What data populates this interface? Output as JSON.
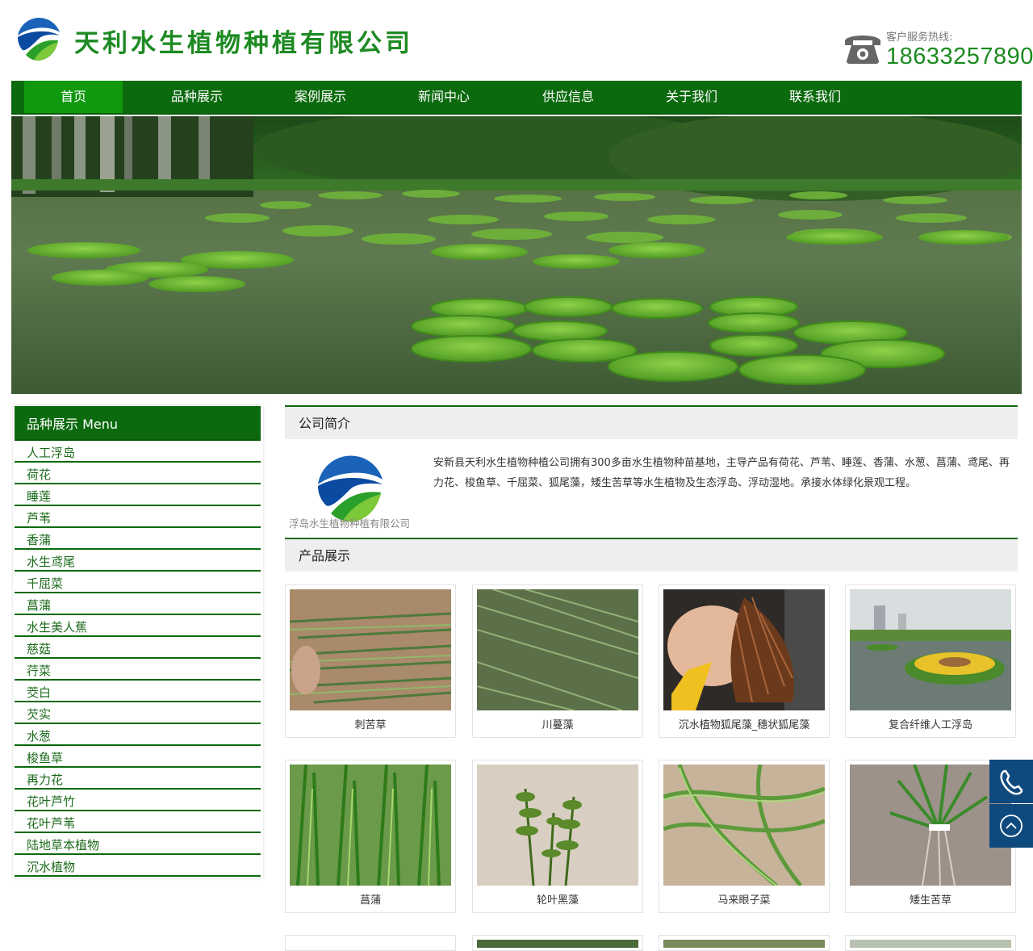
{
  "header": {
    "company_name": "天利水生植物种植有限公司",
    "hotline_label": "客户服务热线:",
    "hotline_number": "18633257890"
  },
  "nav": {
    "items": [
      "首页",
      "品种展示",
      "案例展示",
      "新闻中心",
      "供应信息",
      "关于我们",
      "联系我们"
    ],
    "active_index": 0
  },
  "sidebar": {
    "title": "品种展示 Menu",
    "items": [
      "人工浮岛",
      "荷花",
      "睡莲",
      "芦苇",
      "香蒲",
      "水生鸢尾",
      "千屈菜",
      "菖蒲",
      "水生美人蕉",
      "慈菇",
      "荇菜",
      "茭白",
      "芡实",
      "水葱",
      "梭鱼草",
      "再力花",
      "花叶芦竹",
      "花叶芦苇",
      "陆地草本植物",
      "沉水植物"
    ]
  },
  "intro": {
    "title": "公司简介",
    "logo_caption": "浮岛水生植物种植有限公司",
    "text": "安新县天利水生植物种植公司拥有300多亩水生植物种苗基地，主导产品有荷花、芦苇、睡莲、香蒲、水葱、菖蒲、鸢尾、再力花、梭鱼草、千屈菜、狐尾藻，矮生苦草等水生植物及生态浮岛、浮动湿地。承接水体绿化景观工程。"
  },
  "products": {
    "title": "产品展示",
    "items": [
      "刺苦草",
      "川蔓藻",
      "沉水植物狐尾藻_穗状狐尾藻",
      "复合纤维人工浮岛",
      "菖蒲",
      "轮叶黑藻",
      "马来眼子菜",
      "矮生苦草"
    ]
  },
  "colors": {
    "nav_green": "#0c6a0e",
    "nav_active": "#10980f",
    "brand_green": "#1e8a23",
    "float_blue": "#0e4a7e"
  },
  "icons": {
    "phone": "phone-icon",
    "float_phone": "phone-icon",
    "back_to_top": "arrow-up-circle-icon"
  }
}
